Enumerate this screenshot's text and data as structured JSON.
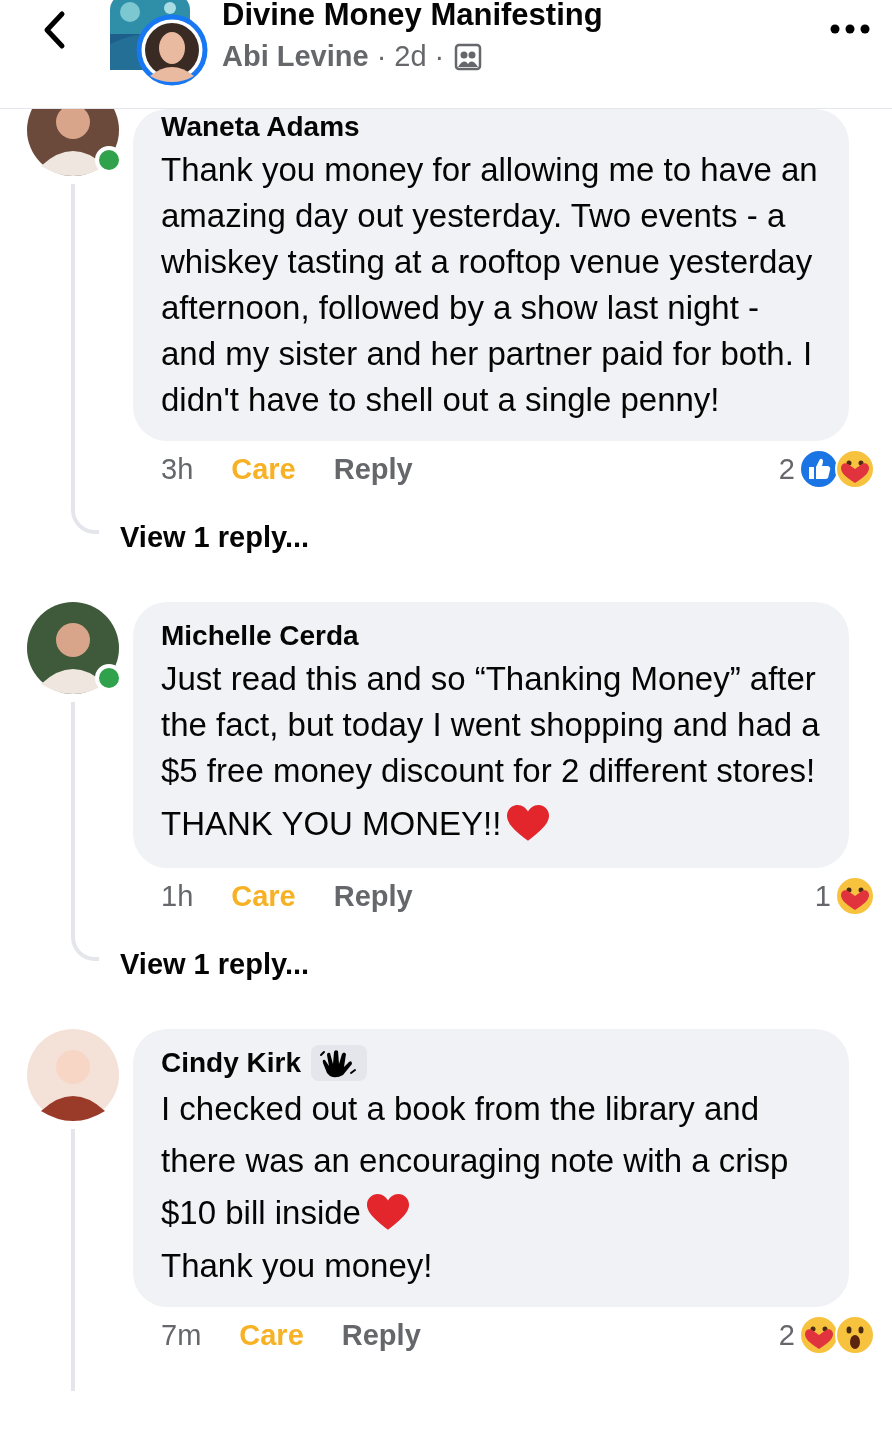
{
  "header": {
    "title": "Divine Money Manifesting",
    "author": "Abi Levine",
    "separator": "·",
    "time": "2d"
  },
  "comments": [
    {
      "name": "Waneta Adams",
      "online": true,
      "badge": false,
      "paragraphs": [
        {
          "text": "Thank you money for allowing me to have an amazing day out yesterday. Two events - a whiskey tasting at a rooftop venue yesterday afternoon, followed by a show last night - and my sister and her partner paid for both. I didn't have to shell out a single penny!",
          "heart": false
        }
      ],
      "time": "3h",
      "reaction_label": "Care",
      "reacted": true,
      "reply_label": "Reply",
      "reaction_count": "2",
      "reactions": [
        {
          "kind": "like"
        },
        {
          "kind": "care"
        }
      ],
      "view_replies": "View 1 reply..."
    },
    {
      "name": "Michelle Cerda",
      "online": true,
      "badge": false,
      "paragraphs": [
        {
          "text": "Just read this and so “Thanking Money” after the fact, but today I went shopping and had a $5 free money discount for 2 different stores!",
          "heart": false
        },
        {
          "text": "THANK YOU MONEY!!",
          "heart": true
        }
      ],
      "time": "1h",
      "reaction_label": "Care",
      "reacted": true,
      "reply_label": "Reply",
      "reaction_count": "1",
      "reactions": [
        {
          "kind": "care"
        }
      ],
      "view_replies": "View 1 reply..."
    },
    {
      "name": "Cindy Kirk",
      "online": false,
      "badge": true,
      "paragraphs": [
        {
          "text": "I checked out a book from the library and there was an encouraging note with a crisp $10 bill inside",
          "heart": true
        },
        {
          "text": "Thank you money!",
          "heart": false
        }
      ],
      "time": "7m",
      "reaction_label": "Care",
      "reacted": true,
      "reply_label": "Reply",
      "reaction_count": "2",
      "reactions": [
        {
          "kind": "care"
        },
        {
          "kind": "wow"
        }
      ]
    }
  ]
}
